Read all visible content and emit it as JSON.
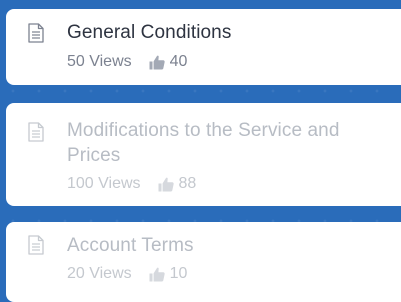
{
  "articles": [
    {
      "title": "General Conditions",
      "views": "50 Views",
      "likes": "40"
    },
    {
      "title": "Modifications to the Service and Prices",
      "views": "100 Views",
      "likes": "88"
    },
    {
      "title": "Account Terms",
      "views": "20 Views",
      "likes": "10"
    }
  ],
  "icons": {
    "document": "document-icon",
    "like": "thumbs-up-icon"
  },
  "colors": {
    "background": "#2a6cba",
    "card": "#ffffff",
    "title_active": "#2e3441",
    "title_faded": "#b7bcc4"
  }
}
